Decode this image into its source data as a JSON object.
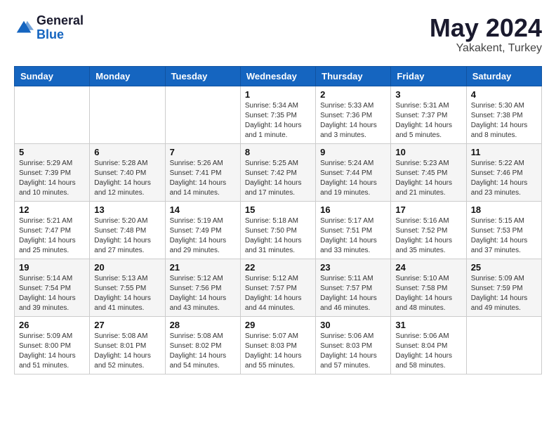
{
  "header": {
    "logo_general": "General",
    "logo_blue": "Blue",
    "month_title": "May 2024",
    "location": "Yakakent, Turkey"
  },
  "weekdays": [
    "Sunday",
    "Monday",
    "Tuesday",
    "Wednesday",
    "Thursday",
    "Friday",
    "Saturday"
  ],
  "weeks": [
    [
      {
        "day": "",
        "info": ""
      },
      {
        "day": "",
        "info": ""
      },
      {
        "day": "",
        "info": ""
      },
      {
        "day": "1",
        "info": "Sunrise: 5:34 AM\nSunset: 7:35 PM\nDaylight: 14 hours\nand 1 minute."
      },
      {
        "day": "2",
        "info": "Sunrise: 5:33 AM\nSunset: 7:36 PM\nDaylight: 14 hours\nand 3 minutes."
      },
      {
        "day": "3",
        "info": "Sunrise: 5:31 AM\nSunset: 7:37 PM\nDaylight: 14 hours\nand 5 minutes."
      },
      {
        "day": "4",
        "info": "Sunrise: 5:30 AM\nSunset: 7:38 PM\nDaylight: 14 hours\nand 8 minutes."
      }
    ],
    [
      {
        "day": "5",
        "info": "Sunrise: 5:29 AM\nSunset: 7:39 PM\nDaylight: 14 hours\nand 10 minutes."
      },
      {
        "day": "6",
        "info": "Sunrise: 5:28 AM\nSunset: 7:40 PM\nDaylight: 14 hours\nand 12 minutes."
      },
      {
        "day": "7",
        "info": "Sunrise: 5:26 AM\nSunset: 7:41 PM\nDaylight: 14 hours\nand 14 minutes."
      },
      {
        "day": "8",
        "info": "Sunrise: 5:25 AM\nSunset: 7:42 PM\nDaylight: 14 hours\nand 17 minutes."
      },
      {
        "day": "9",
        "info": "Sunrise: 5:24 AM\nSunset: 7:44 PM\nDaylight: 14 hours\nand 19 minutes."
      },
      {
        "day": "10",
        "info": "Sunrise: 5:23 AM\nSunset: 7:45 PM\nDaylight: 14 hours\nand 21 minutes."
      },
      {
        "day": "11",
        "info": "Sunrise: 5:22 AM\nSunset: 7:46 PM\nDaylight: 14 hours\nand 23 minutes."
      }
    ],
    [
      {
        "day": "12",
        "info": "Sunrise: 5:21 AM\nSunset: 7:47 PM\nDaylight: 14 hours\nand 25 minutes."
      },
      {
        "day": "13",
        "info": "Sunrise: 5:20 AM\nSunset: 7:48 PM\nDaylight: 14 hours\nand 27 minutes."
      },
      {
        "day": "14",
        "info": "Sunrise: 5:19 AM\nSunset: 7:49 PM\nDaylight: 14 hours\nand 29 minutes."
      },
      {
        "day": "15",
        "info": "Sunrise: 5:18 AM\nSunset: 7:50 PM\nDaylight: 14 hours\nand 31 minutes."
      },
      {
        "day": "16",
        "info": "Sunrise: 5:17 AM\nSunset: 7:51 PM\nDaylight: 14 hours\nand 33 minutes."
      },
      {
        "day": "17",
        "info": "Sunrise: 5:16 AM\nSunset: 7:52 PM\nDaylight: 14 hours\nand 35 minutes."
      },
      {
        "day": "18",
        "info": "Sunrise: 5:15 AM\nSunset: 7:53 PM\nDaylight: 14 hours\nand 37 minutes."
      }
    ],
    [
      {
        "day": "19",
        "info": "Sunrise: 5:14 AM\nSunset: 7:54 PM\nDaylight: 14 hours\nand 39 minutes."
      },
      {
        "day": "20",
        "info": "Sunrise: 5:13 AM\nSunset: 7:55 PM\nDaylight: 14 hours\nand 41 minutes."
      },
      {
        "day": "21",
        "info": "Sunrise: 5:12 AM\nSunset: 7:56 PM\nDaylight: 14 hours\nand 43 minutes."
      },
      {
        "day": "22",
        "info": "Sunrise: 5:12 AM\nSunset: 7:57 PM\nDaylight: 14 hours\nand 44 minutes."
      },
      {
        "day": "23",
        "info": "Sunrise: 5:11 AM\nSunset: 7:57 PM\nDaylight: 14 hours\nand 46 minutes."
      },
      {
        "day": "24",
        "info": "Sunrise: 5:10 AM\nSunset: 7:58 PM\nDaylight: 14 hours\nand 48 minutes."
      },
      {
        "day": "25",
        "info": "Sunrise: 5:09 AM\nSunset: 7:59 PM\nDaylight: 14 hours\nand 49 minutes."
      }
    ],
    [
      {
        "day": "26",
        "info": "Sunrise: 5:09 AM\nSunset: 8:00 PM\nDaylight: 14 hours\nand 51 minutes."
      },
      {
        "day": "27",
        "info": "Sunrise: 5:08 AM\nSunset: 8:01 PM\nDaylight: 14 hours\nand 52 minutes."
      },
      {
        "day": "28",
        "info": "Sunrise: 5:08 AM\nSunset: 8:02 PM\nDaylight: 14 hours\nand 54 minutes."
      },
      {
        "day": "29",
        "info": "Sunrise: 5:07 AM\nSunset: 8:03 PM\nDaylight: 14 hours\nand 55 minutes."
      },
      {
        "day": "30",
        "info": "Sunrise: 5:06 AM\nSunset: 8:03 PM\nDaylight: 14 hours\nand 57 minutes."
      },
      {
        "day": "31",
        "info": "Sunrise: 5:06 AM\nSunset: 8:04 PM\nDaylight: 14 hours\nand 58 minutes."
      },
      {
        "day": "",
        "info": ""
      }
    ]
  ]
}
